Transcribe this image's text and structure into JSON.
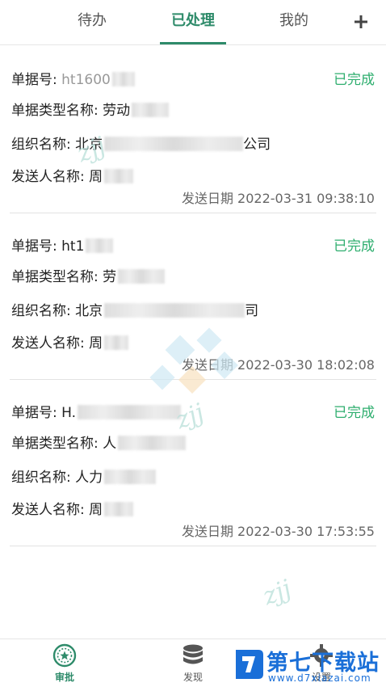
{
  "tabs": {
    "pending": "待办",
    "processed": "已处理",
    "mine": "我的",
    "add_icon": "plus-icon"
  },
  "records": [
    {
      "doc_no_label": "单据号:",
      "doc_no_value": "ht1600",
      "type_label": "单据类型名称:",
      "type_value": "劳动",
      "org_label": "组织名称:",
      "org_value": "北京",
      "org_suffix": "公司",
      "sender_label": "发送人名称:",
      "sender_value": "周",
      "status": "已完成",
      "date": "发送日期 2022-03-31 09:38:10"
    },
    {
      "doc_no_label": "单据号:",
      "doc_no_value": "ht1",
      "type_label": "单据类型名称:",
      "type_value": "劳",
      "org_label": "组织名称:",
      "org_value": "北京",
      "org_suffix": "司",
      "sender_label": "发送人名称:",
      "sender_value": "周",
      "status": "已完成",
      "date": "发送日期 2022-03-30 18:02:08"
    },
    {
      "doc_no_label": "单据号:",
      "doc_no_value": "H.",
      "type_label": "单据类型名称:",
      "type_value": "人",
      "org_label": "组织名称:",
      "org_value": "人力",
      "org_suffix": "",
      "sender_label": "发送人名称:",
      "sender_value": "周",
      "status": "已完成",
      "date": "发送日期 2022-03-30 17:53:55"
    }
  ],
  "watermark": "zjj",
  "bottom_nav": {
    "approve": "审批",
    "discover": "发现",
    "settings": "设置"
  },
  "brand": {
    "name": "第七下载站",
    "url": "www.d7xiazai.com"
  },
  "colors": {
    "accent": "#2e8b6a",
    "status_done": "#2eae6e",
    "brand_blue": "#1a6fd8"
  }
}
